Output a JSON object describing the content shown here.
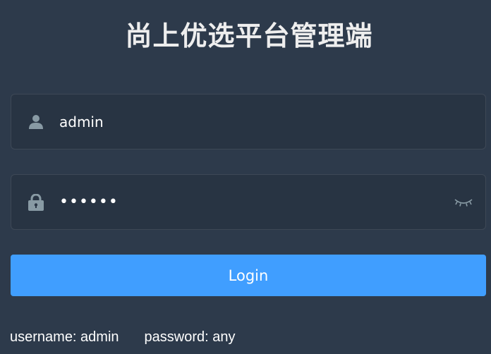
{
  "title": "尚上优选平台管理端",
  "username": {
    "icon": "user-icon",
    "value": "admin"
  },
  "password": {
    "icon": "lock-icon",
    "value": "••••••",
    "toggle_icon": "eye-closed-icon"
  },
  "login": {
    "label": "Login"
  },
  "tips": {
    "username": "username: admin",
    "password": "password: any"
  },
  "colors": {
    "background": "#2d3a4b",
    "accent": "#409eff",
    "icon": "#889aa4"
  }
}
